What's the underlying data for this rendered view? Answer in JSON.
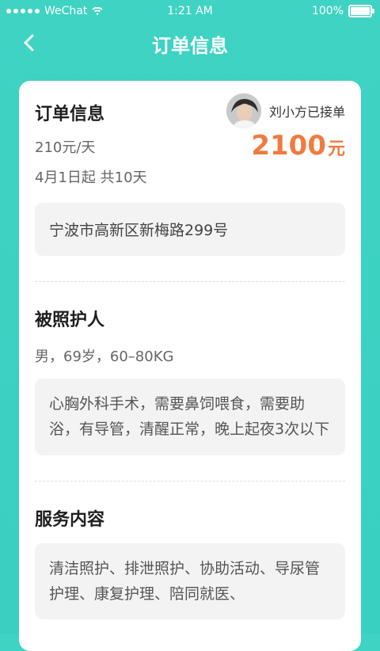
{
  "status": {
    "carrier": "WeChat",
    "time": "1:21 AM",
    "battery": "100%",
    "battery_level": 1.0
  },
  "nav": {
    "title": "订单信息"
  },
  "order": {
    "section_title": "订单信息",
    "caretaker_status": "刘小方已接单",
    "unit_price": "210元/天",
    "total_number": "2100",
    "total_unit": "元",
    "date_range": "4月1日起 共10天",
    "address": "宁波市高新区新梅路299号"
  },
  "patient": {
    "title": "被照护人",
    "summary": "男，69岁，60–80KG",
    "description": "心胸外科手术，需要鼻饲喂食，需要助浴，有导管，清醒正常，晚上起夜3次以下"
  },
  "services": {
    "title": "服务内容",
    "content": "清洁照护、排泄照护、协助活动、导尿管护理、康复护理、陪同就医、"
  },
  "colors": {
    "accent": "#3fd3c3",
    "price": "#f07b3f"
  },
  "icons": {
    "back": "chevron-left-icon",
    "wifi": "wifi-icon",
    "battery": "battery-icon"
  }
}
